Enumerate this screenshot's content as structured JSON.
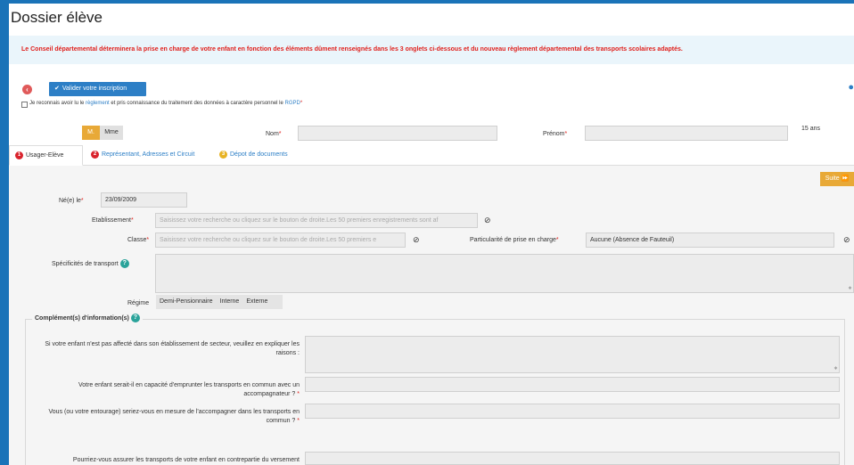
{
  "page": {
    "title": "Dossier élève",
    "info_banner": "Le Conseil départemental déterminera la prise en charge de votre enfant en fonction des éléments dûment renseignés dans les 3 onglets ci-dessous et du nouveau règlement départemental des transports scolaires adaptés."
  },
  "toolbar": {
    "validate_label": "Valider votre inscription"
  },
  "consent": {
    "prefix": "Je reconnais avoir lu le ",
    "link1": "règlement",
    "middle": " et pris connaissance du traitement des données à caractère personnel le ",
    "link2": "RGPD",
    "star": "*"
  },
  "identity": {
    "civ_m": "M.",
    "civ_mme": "Mme",
    "nom_label": "Nom",
    "prenom_label": "Prénom",
    "age": "15 ans"
  },
  "tabs": [
    {
      "num": "1",
      "label": "Usager-Elève"
    },
    {
      "num": "2",
      "label": "Représentant, Adresses et Circuit"
    },
    {
      "num": "3",
      "label": "Dépot de documents"
    }
  ],
  "form": {
    "suite_label": "Suite ⏩",
    "birth_label": "Né(e) le",
    "birth_value": "23/09/2009",
    "etablissement_label": "Etablissement",
    "etablissement_placeholder": "Saisissez votre recherche ou cliquez sur le bouton de droite.Les 50 premiers enregistrements sont af",
    "classe_label": "Classe",
    "classe_placeholder": "Saisissez votre recherche ou cliquez sur le bouton de droite.Les 50 premiers e",
    "particularite_label": "Particularité de prise en charge",
    "particularite_value": "Aucune (Absence de Fauteuil)",
    "specificites_label": "Spécificités de transport",
    "regime_label": "Régime",
    "regime_options": [
      "Demi-Pensionnaire",
      "Interne",
      "Externe"
    ]
  },
  "complement": {
    "legend": "Complément(s) d'information(s)",
    "q1": "Si votre enfant n'est pas affecté dans son établissement de secteur, veuillez en expliquer les raisons :",
    "q2": "Votre enfant serait-il en capacité d'emprunter les transports en commun avec un accompagnateur ?",
    "q3": "Vous (ou votre entourage) seriez-vous en mesure de l'accompagner dans les transports en commun ?",
    "q4": "Pourriez-vous assurer les transports de votre enfant en contrepartie du versement"
  },
  "colors": {
    "primary": "#2d7fc6",
    "accent": "#e8a937",
    "required": "#e0201c"
  }
}
